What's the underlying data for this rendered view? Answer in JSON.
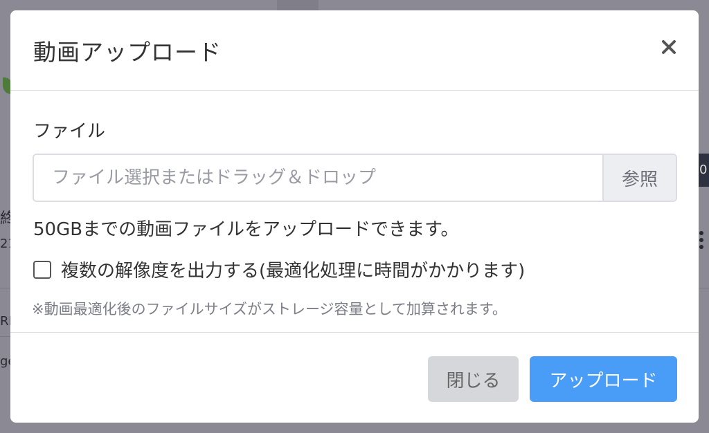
{
  "background": {
    "fragments": [
      "終",
      "21",
      "RL",
      "ge",
      "0"
    ]
  },
  "modal": {
    "title": "動画アップロード",
    "close_icon": "close-icon",
    "file_label": "ファイル",
    "file_placeholder": "ファイル選択またはドラッグ＆ドロップ",
    "browse_label": "参照",
    "help_text": "50GBまでの動画ファイルをアップロードできます。",
    "checkbox_label": "複数の解像度を出力する(最適化処理に時間がかかります)",
    "checkbox_checked": false,
    "note_text": "※動画最適化後のファイルサイズがストレージ容量として加算されます。",
    "close_button_label": "閉じる",
    "upload_button_label": "アップロード"
  },
  "colors": {
    "overlay": "#8a8994",
    "primary": "#4a9df6",
    "secondary": "#d5d7db"
  }
}
